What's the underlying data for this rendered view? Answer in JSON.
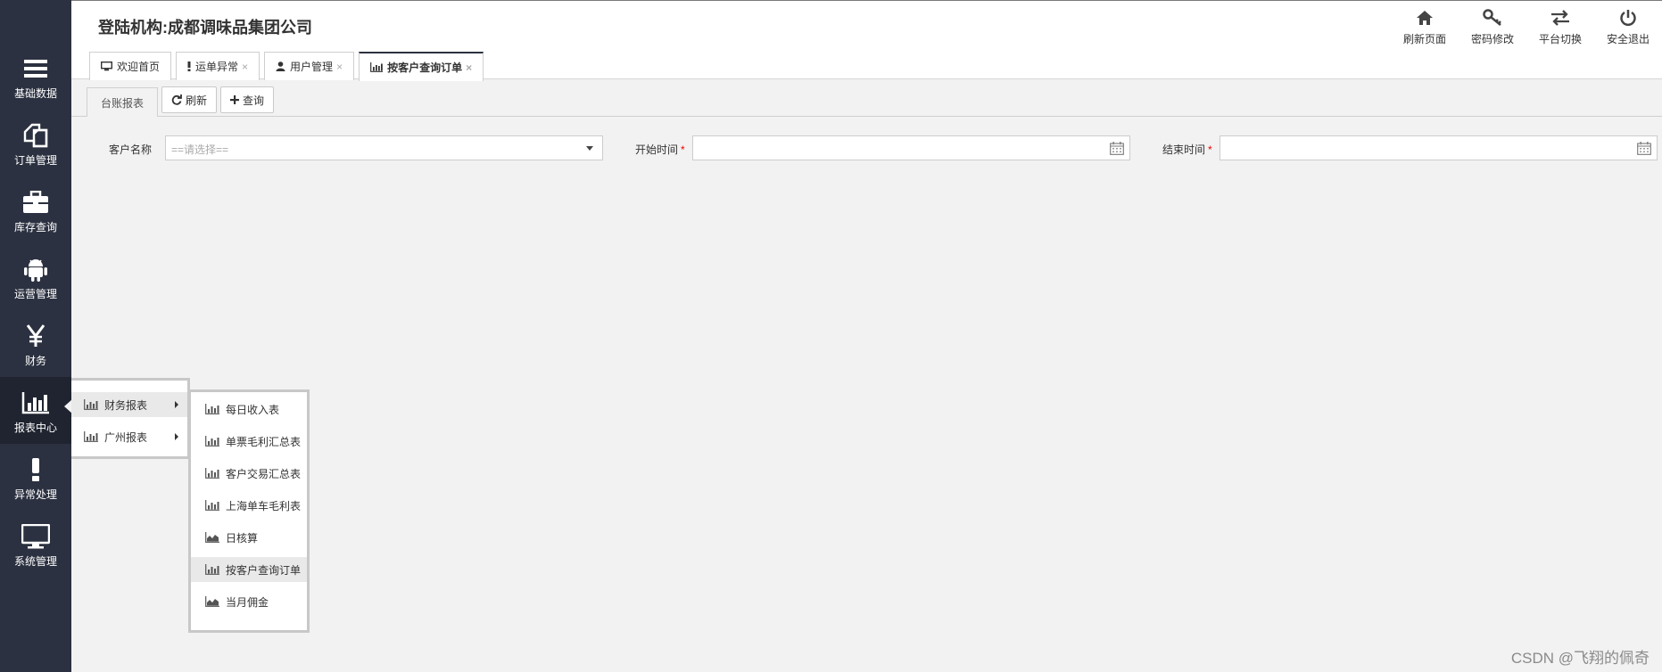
{
  "header": {
    "org_title": "登陆机构:成都调味品集团公司",
    "actions": [
      {
        "label": "刷新页面",
        "icon": "home-icon"
      },
      {
        "label": "密码修改",
        "icon": "key-icon"
      },
      {
        "label": "平台切换",
        "icon": "switch-icon"
      },
      {
        "label": "安全退出",
        "icon": "power-icon"
      }
    ]
  },
  "sidebar": {
    "items": [
      {
        "label": "基础数据",
        "icon": "menu-icon"
      },
      {
        "label": "订单管理",
        "icon": "copy-icon"
      },
      {
        "label": "库存查询",
        "icon": "briefcase-icon"
      },
      {
        "label": "运营管理",
        "icon": "android-icon"
      },
      {
        "label": "财务",
        "icon": "yen-icon"
      },
      {
        "label": "报表中心",
        "icon": "bar-chart-icon"
      },
      {
        "label": "异常处理",
        "icon": "exclamation-icon"
      },
      {
        "label": "系统管理",
        "icon": "monitor-icon"
      }
    ],
    "active_index": 5
  },
  "tabs": [
    {
      "label": "欢迎首页",
      "icon": "monitor-icon",
      "closable": false
    },
    {
      "label": "运单异常",
      "icon": "exclamation-icon",
      "closable": true
    },
    {
      "label": "用户管理",
      "icon": "user-icon",
      "closable": true
    },
    {
      "label": "按客户查询订单",
      "icon": "bar-chart-icon",
      "closable": true,
      "active": true
    }
  ],
  "toolbar": {
    "tab_label": "台账报表",
    "refresh_label": "刷新",
    "query_label": "查询"
  },
  "form": {
    "customer_label": "客户名称",
    "customer_placeholder": "==请选择==",
    "start_label": "开始时间",
    "end_label": "结束时间",
    "required_mark": "*"
  },
  "menu_level1": [
    {
      "label": "财务报表",
      "has_sub": true
    },
    {
      "label": "广州报表",
      "has_sub": true
    }
  ],
  "menu_level2": [
    {
      "label": "每日收入表",
      "icon": "bar-chart-icon"
    },
    {
      "label": "单票毛利汇总表",
      "icon": "bar-chart-icon"
    },
    {
      "label": "客户交易汇总表",
      "icon": "bar-chart-icon"
    },
    {
      "label": "上海单车毛利表",
      "icon": "bar-chart-icon"
    },
    {
      "label": "日核算",
      "icon": "area-chart-icon"
    },
    {
      "label": "按客户查询订单",
      "icon": "bar-chart-icon",
      "highlighted": true
    },
    {
      "label": "当月佣金",
      "icon": "area-chart-icon"
    }
  ],
  "watermark": "CSDN @飞翔的佩奇",
  "colors": {
    "sidebar": "#2b3140",
    "sidebar_active": "#1f2430",
    "required": "#ee0000"
  }
}
